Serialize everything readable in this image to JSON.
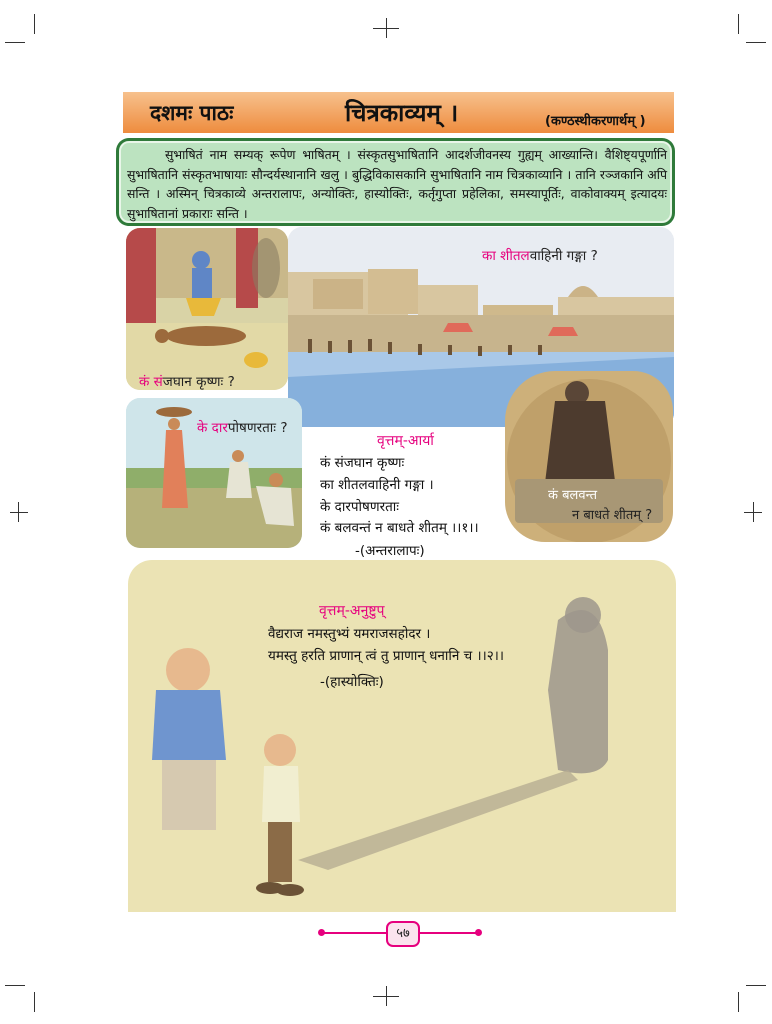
{
  "header": {
    "lesson_label": "दशमः पाठः",
    "title": "चित्रकाव्यम् ।",
    "note": "(कण्ठस्थीकरणार्थम् )"
  },
  "intro": {
    "text": "सुभाषितं नाम सम्यक् रूपेण भाषितम् । संस्कृतसुभाषितानि आदर्शजीवनस्य गुह्यम् आख्यान्ति। वैशिष्ट्यपूर्णानि सुभाषितानि संस्कृतभाषायाः सौन्दर्यस्थानानि खलु । बुद्धिविकासकानि सुभाषितानि नाम चित्रकाव्यानि । तानि रञ्जकानि अपि सन्ति । अस्मिन् चित्रकाव्ये अन्तरालापः, अन्योक्तिः, हास्योक्तिः, कर्तृगुप्ता प्रहेलिका, समस्यापूर्तिः, वाकोवाक्यम् इत्यादयः सुभाषितानां प्रकाराः सन्ति ।"
  },
  "captions": {
    "krishna": {
      "highlight": "कं सं",
      "rest": "जघान कृष्णः ?"
    },
    "ganga": {
      "highlight": "का शीतल",
      "rest": "वाहिनी गङ्गा ?"
    },
    "daara": {
      "highlight": "के दार",
      "rest": "पोषणरताः ?"
    },
    "cold": {
      "highlight": "कं बलवन्त",
      "rest": "न बाधते शीतम् ?"
    }
  },
  "verse1": {
    "title": "वृत्तम्-आर्या",
    "lines": [
      "कं संजघान कृष्णः",
      "का शीतलवाहिनी गङ्गा ।",
      "के दारपोषणरताः",
      "कं बलवन्तं न बाधते शीतम् ।।१।।"
    ],
    "source": "-(अन्तरालापः)"
  },
  "verse2": {
    "title": "वृत्तम्-अनुष्टुप्",
    "lines": [
      "वैद्यराज नमस्तुभ्यं यमराजसहोदर ।",
      "यमस्तु हरति प्राणान् त्वं तु प्राणान् धनानि च ।।२।।"
    ],
    "source": "-(हास्योक्तिः)"
  },
  "page_number": "५७",
  "colors": {
    "header": "#ee8c3e",
    "intro_bg": "#bce3c0",
    "intro_border": "#2f7a3a",
    "accent": "#e6007e",
    "beige": "#ebe3b4"
  }
}
